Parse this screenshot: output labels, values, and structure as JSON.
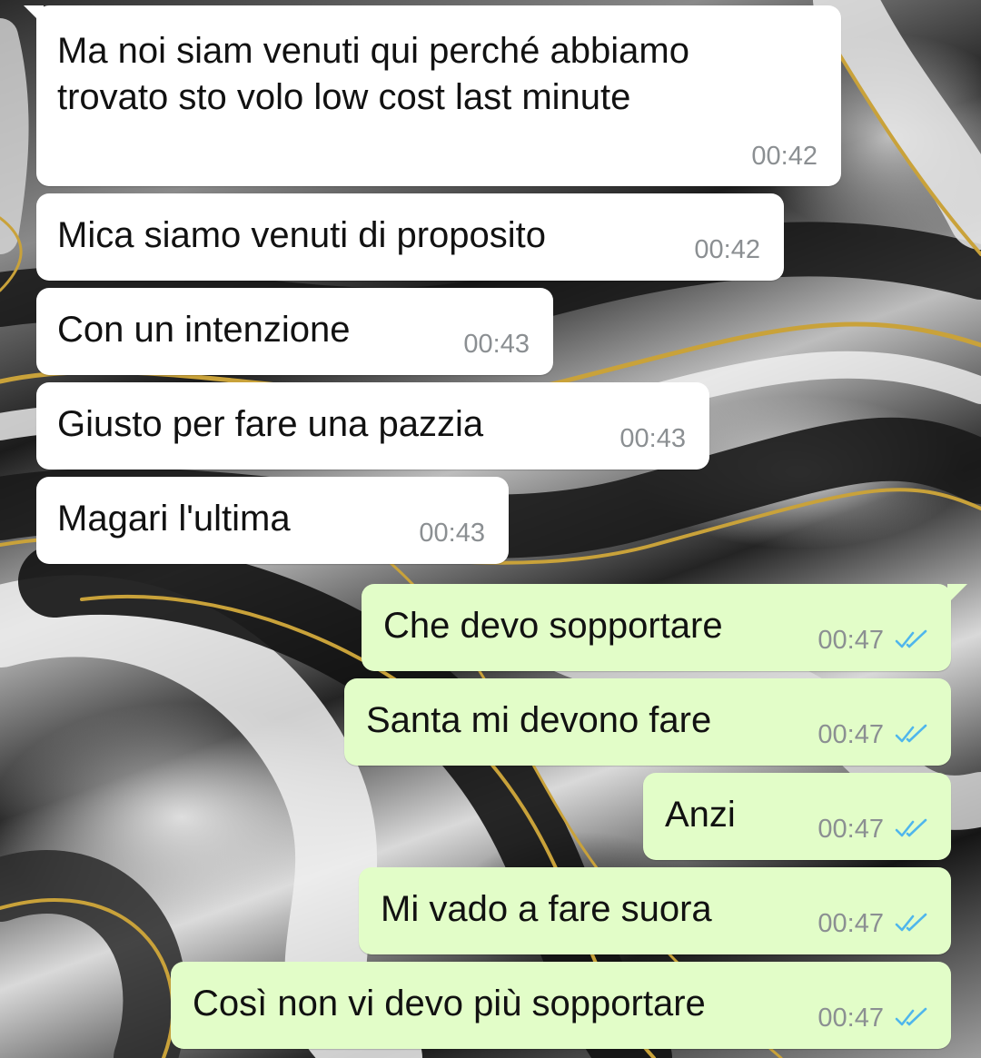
{
  "chat": {
    "messages": [
      {
        "direction": "incoming",
        "text": "Ma noi siam venuti qui perché abbiamo\ntrovato sto volo low cost last minute",
        "time": "00:42"
      },
      {
        "direction": "incoming",
        "text": "Mica siamo venuti di proposito",
        "time": "00:42"
      },
      {
        "direction": "incoming",
        "text": "Con un intenzione",
        "time": "00:43"
      },
      {
        "direction": "incoming",
        "text": "Giusto per fare una pazzia",
        "time": "00:43"
      },
      {
        "direction": "incoming",
        "text": "Magari l'ultima",
        "time": "00:43"
      },
      {
        "direction": "outgoing",
        "text": "Che devo sopportare",
        "time": "00:47",
        "status_icon": "double-check-read-icon"
      },
      {
        "direction": "outgoing",
        "text": "Santa mi devono fare",
        "time": "00:47",
        "status_icon": "double-check-read-icon"
      },
      {
        "direction": "outgoing",
        "text": "Anzi",
        "time": "00:47",
        "status_icon": "double-check-read-icon"
      },
      {
        "direction": "outgoing",
        "text": "Mi vado a fare suora",
        "time": "00:47",
        "status_icon": "double-check-read-icon"
      },
      {
        "direction": "outgoing",
        "text": "Così non vi devo più sopportare",
        "time": "00:47",
        "status_icon": "double-check-read-icon"
      }
    ]
  },
  "colors": {
    "incoming_bubble": "#ffffff",
    "outgoing_bubble": "#e2fdc8",
    "read_ticks": "#4fb6ec",
    "timestamp": "#8b8f92",
    "wallpaper_gold": "#c9a23a"
  }
}
